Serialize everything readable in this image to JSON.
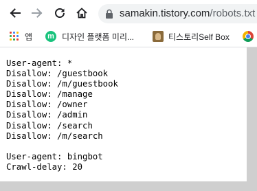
{
  "browser": {
    "url_host": "samakin.tistory.com",
    "url_path": "/robots.txt"
  },
  "bookmarks": [
    {
      "label": "앱",
      "icon": "apps-grid-icon"
    },
    {
      "label": "디자인 플랫폼 미리...",
      "icon": "m-logo-icon"
    },
    {
      "label": "티스토리Self Box",
      "icon": "tistory-favicon-icon"
    },
    {
      "label": "",
      "icon": "chrome-icon"
    }
  ],
  "colors": {
    "apps_grid": [
      "#ea4335",
      "#4285f4",
      "#fbbc05",
      "#34a853",
      "#ea4335",
      "#4285f4",
      "#fbbc05",
      "#34a853",
      "#ea4335"
    ],
    "m_logo": "#19c37d"
  },
  "page": {
    "lines": [
      "User-agent: *",
      "Disallow: /guestbook",
      "Disallow: /m/guestbook",
      "Disallow: /manage",
      "Disallow: /owner",
      "Disallow: /admin",
      "Disallow: /search",
      "Disallow: /m/search",
      "",
      "User-agent: bingbot",
      "Crawl-delay: 20"
    ]
  }
}
